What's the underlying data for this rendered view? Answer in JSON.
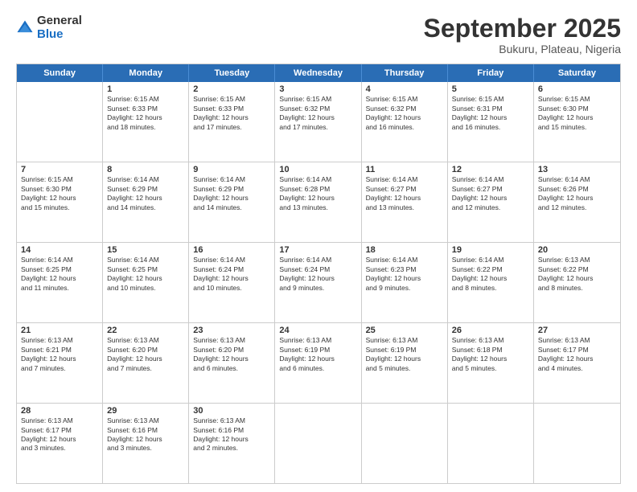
{
  "logo": {
    "general": "General",
    "blue": "Blue"
  },
  "title": {
    "month": "September 2025",
    "location": "Bukuru, Plateau, Nigeria"
  },
  "calendar": {
    "headers": [
      "Sunday",
      "Monday",
      "Tuesday",
      "Wednesday",
      "Thursday",
      "Friday",
      "Saturday"
    ],
    "rows": [
      [
        {
          "day": "",
          "info": ""
        },
        {
          "day": "1",
          "info": "Sunrise: 6:15 AM\nSunset: 6:33 PM\nDaylight: 12 hours\nand 18 minutes."
        },
        {
          "day": "2",
          "info": "Sunrise: 6:15 AM\nSunset: 6:33 PM\nDaylight: 12 hours\nand 17 minutes."
        },
        {
          "day": "3",
          "info": "Sunrise: 6:15 AM\nSunset: 6:32 PM\nDaylight: 12 hours\nand 17 minutes."
        },
        {
          "day": "4",
          "info": "Sunrise: 6:15 AM\nSunset: 6:32 PM\nDaylight: 12 hours\nand 16 minutes."
        },
        {
          "day": "5",
          "info": "Sunrise: 6:15 AM\nSunset: 6:31 PM\nDaylight: 12 hours\nand 16 minutes."
        },
        {
          "day": "6",
          "info": "Sunrise: 6:15 AM\nSunset: 6:30 PM\nDaylight: 12 hours\nand 15 minutes."
        }
      ],
      [
        {
          "day": "7",
          "info": "Sunrise: 6:15 AM\nSunset: 6:30 PM\nDaylight: 12 hours\nand 15 minutes."
        },
        {
          "day": "8",
          "info": "Sunrise: 6:14 AM\nSunset: 6:29 PM\nDaylight: 12 hours\nand 14 minutes."
        },
        {
          "day": "9",
          "info": "Sunrise: 6:14 AM\nSunset: 6:29 PM\nDaylight: 12 hours\nand 14 minutes."
        },
        {
          "day": "10",
          "info": "Sunrise: 6:14 AM\nSunset: 6:28 PM\nDaylight: 12 hours\nand 13 minutes."
        },
        {
          "day": "11",
          "info": "Sunrise: 6:14 AM\nSunset: 6:27 PM\nDaylight: 12 hours\nand 13 minutes."
        },
        {
          "day": "12",
          "info": "Sunrise: 6:14 AM\nSunset: 6:27 PM\nDaylight: 12 hours\nand 12 minutes."
        },
        {
          "day": "13",
          "info": "Sunrise: 6:14 AM\nSunset: 6:26 PM\nDaylight: 12 hours\nand 12 minutes."
        }
      ],
      [
        {
          "day": "14",
          "info": "Sunrise: 6:14 AM\nSunset: 6:25 PM\nDaylight: 12 hours\nand 11 minutes."
        },
        {
          "day": "15",
          "info": "Sunrise: 6:14 AM\nSunset: 6:25 PM\nDaylight: 12 hours\nand 10 minutes."
        },
        {
          "day": "16",
          "info": "Sunrise: 6:14 AM\nSunset: 6:24 PM\nDaylight: 12 hours\nand 10 minutes."
        },
        {
          "day": "17",
          "info": "Sunrise: 6:14 AM\nSunset: 6:24 PM\nDaylight: 12 hours\nand 9 minutes."
        },
        {
          "day": "18",
          "info": "Sunrise: 6:14 AM\nSunset: 6:23 PM\nDaylight: 12 hours\nand 9 minutes."
        },
        {
          "day": "19",
          "info": "Sunrise: 6:14 AM\nSunset: 6:22 PM\nDaylight: 12 hours\nand 8 minutes."
        },
        {
          "day": "20",
          "info": "Sunrise: 6:13 AM\nSunset: 6:22 PM\nDaylight: 12 hours\nand 8 minutes."
        }
      ],
      [
        {
          "day": "21",
          "info": "Sunrise: 6:13 AM\nSunset: 6:21 PM\nDaylight: 12 hours\nand 7 minutes."
        },
        {
          "day": "22",
          "info": "Sunrise: 6:13 AM\nSunset: 6:20 PM\nDaylight: 12 hours\nand 7 minutes."
        },
        {
          "day": "23",
          "info": "Sunrise: 6:13 AM\nSunset: 6:20 PM\nDaylight: 12 hours\nand 6 minutes."
        },
        {
          "day": "24",
          "info": "Sunrise: 6:13 AM\nSunset: 6:19 PM\nDaylight: 12 hours\nand 6 minutes."
        },
        {
          "day": "25",
          "info": "Sunrise: 6:13 AM\nSunset: 6:19 PM\nDaylight: 12 hours\nand 5 minutes."
        },
        {
          "day": "26",
          "info": "Sunrise: 6:13 AM\nSunset: 6:18 PM\nDaylight: 12 hours\nand 5 minutes."
        },
        {
          "day": "27",
          "info": "Sunrise: 6:13 AM\nSunset: 6:17 PM\nDaylight: 12 hours\nand 4 minutes."
        }
      ],
      [
        {
          "day": "28",
          "info": "Sunrise: 6:13 AM\nSunset: 6:17 PM\nDaylight: 12 hours\nand 3 minutes."
        },
        {
          "day": "29",
          "info": "Sunrise: 6:13 AM\nSunset: 6:16 PM\nDaylight: 12 hours\nand 3 minutes."
        },
        {
          "day": "30",
          "info": "Sunrise: 6:13 AM\nSunset: 6:16 PM\nDaylight: 12 hours\nand 2 minutes."
        },
        {
          "day": "",
          "info": ""
        },
        {
          "day": "",
          "info": ""
        },
        {
          "day": "",
          "info": ""
        },
        {
          "day": "",
          "info": ""
        }
      ]
    ]
  }
}
